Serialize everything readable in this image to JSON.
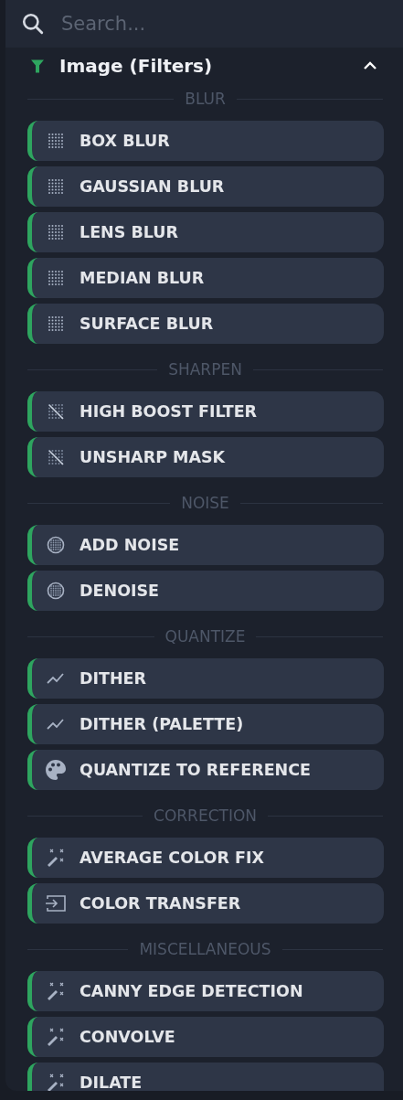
{
  "search": {
    "placeholder": "Search..."
  },
  "group": {
    "title": "Image (Filters)",
    "expanded": true,
    "sections": [
      {
        "label": "BLUR",
        "items": [
          {
            "label": "BOX BLUR",
            "kind": "blur"
          },
          {
            "label": "GAUSSIAN BLUR",
            "kind": "blur"
          },
          {
            "label": "LENS BLUR",
            "kind": "blur"
          },
          {
            "label": "MEDIAN BLUR",
            "kind": "blur"
          },
          {
            "label": "SURFACE BLUR",
            "kind": "blur"
          }
        ]
      },
      {
        "label": "SHARPEN",
        "items": [
          {
            "label": "HIGH BOOST FILTER",
            "kind": "sharpen"
          },
          {
            "label": "UNSHARP MASK",
            "kind": "sharpen"
          }
        ]
      },
      {
        "label": "NOISE",
        "items": [
          {
            "label": "ADD NOISE",
            "kind": "noise"
          },
          {
            "label": "DENOISE",
            "kind": "noise"
          }
        ]
      },
      {
        "label": "QUANTIZE",
        "items": [
          {
            "label": "DITHER",
            "kind": "trend"
          },
          {
            "label": "DITHER (PALETTE)",
            "kind": "trend"
          },
          {
            "label": "QUANTIZE TO REFERENCE",
            "kind": "palette"
          }
        ]
      },
      {
        "label": "CORRECTION",
        "items": [
          {
            "label": "AVERAGE COLOR FIX",
            "kind": "wand"
          },
          {
            "label": "COLOR TRANSFER",
            "kind": "import"
          }
        ]
      },
      {
        "label": "MISCELLANEOUS",
        "items": [
          {
            "label": "CANNY EDGE DETECTION",
            "kind": "wand"
          },
          {
            "label": "CONVOLVE",
            "kind": "wand"
          },
          {
            "label": "DILATE",
            "kind": "wand"
          }
        ]
      }
    ]
  }
}
